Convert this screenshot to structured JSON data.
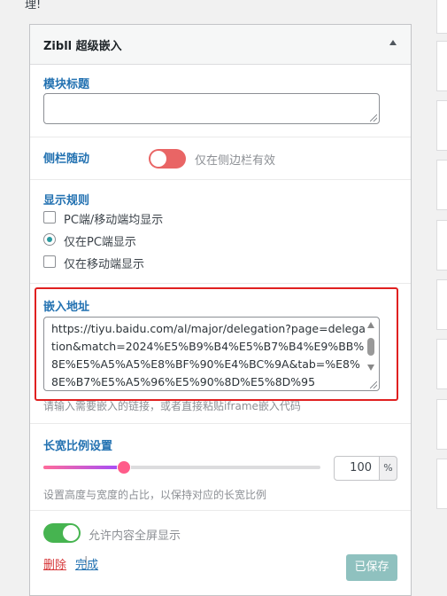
{
  "top_text": "理!",
  "widget": {
    "title": "Zibll 超级嵌入"
  },
  "module_title": {
    "label": "模块标题",
    "value": ""
  },
  "sidebar_follow": {
    "label": "侧栏随动",
    "toggle_on": false,
    "note": "仅在侧边栏有效"
  },
  "display_rules": {
    "label": "显示规则",
    "options": [
      {
        "label": "PC端/移动端均显示",
        "type": "checkbox",
        "checked": false
      },
      {
        "label": "仅在PC端显示",
        "type": "radio",
        "checked": true
      },
      {
        "label": "仅在移动端显示",
        "type": "checkbox",
        "checked": false
      }
    ]
  },
  "embed_url": {
    "label": "嵌入地址",
    "value": "https://tiyu.baidu.com/al/major/delegation?page=delegation&match=2024%E5%B9%B4%E5%B7%B4%E9%BB%8E%E5%A5%A5%E8%BF%90%E4%BC%9A&tab=%E8%8E%B7%E5%A5%96%E5%90%8D%E5%8D%95",
    "hint": "请输入需要嵌入的链接，或者直接粘贴iframe嵌入代码"
  },
  "aspect_ratio": {
    "label": "长宽比例设置",
    "value": "100",
    "unit": "%",
    "slider_fraction": 0.29,
    "hint": "设置高度与宽度的占比，以保持对应的长宽比例"
  },
  "fullscreen": {
    "toggle_on": true,
    "label": "允许内容全屏显示"
  },
  "footer": {
    "delete_label": "删除",
    "separator": "|",
    "done_label": "完成",
    "save_label": "已保存"
  },
  "colors": {
    "accent": "#2271b1",
    "highlight_border": "#e02020",
    "toggle_off": "#e96565",
    "toggle_on": "#46b450",
    "save_disabled": "#8fc1bf"
  }
}
